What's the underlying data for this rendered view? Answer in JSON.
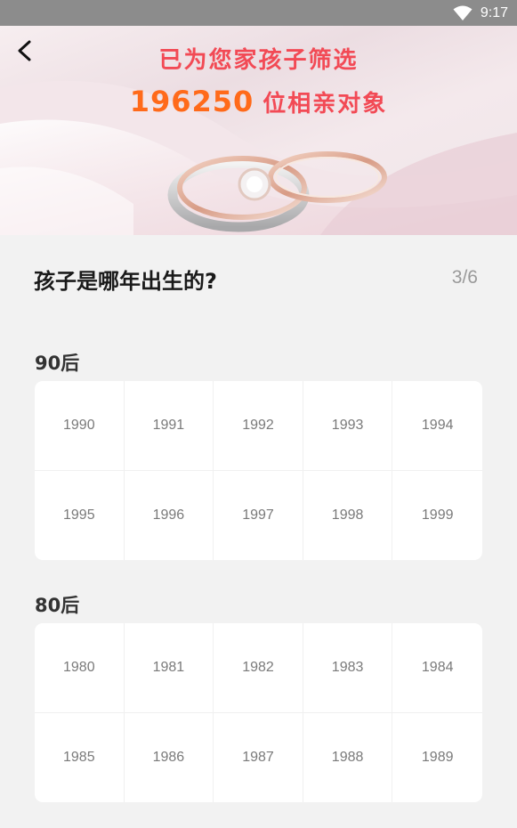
{
  "status_bar": {
    "time": "9:17"
  },
  "hero": {
    "line1": "已为您家孩子筛选",
    "count": "196250",
    "suffix": "位相亲对象"
  },
  "question": {
    "title": "孩子是哪年出生的?",
    "progress": "3/6"
  },
  "groups": [
    {
      "label": "90后",
      "years": [
        "1990",
        "1991",
        "1992",
        "1993",
        "1994",
        "1995",
        "1996",
        "1997",
        "1998",
        "1999"
      ]
    },
    {
      "label": "80后",
      "years": [
        "1980",
        "1981",
        "1982",
        "1983",
        "1984",
        "1985",
        "1986",
        "1987",
        "1988",
        "1989"
      ]
    }
  ],
  "colors": {
    "status_bar": "#8c8c8c",
    "hero_red": "#f24a55",
    "hero_orange": "#ff6a1a",
    "background": "#f2f2f2"
  },
  "icons": {
    "back": "chevron-left-icon",
    "wifi": "wifi-icon"
  }
}
